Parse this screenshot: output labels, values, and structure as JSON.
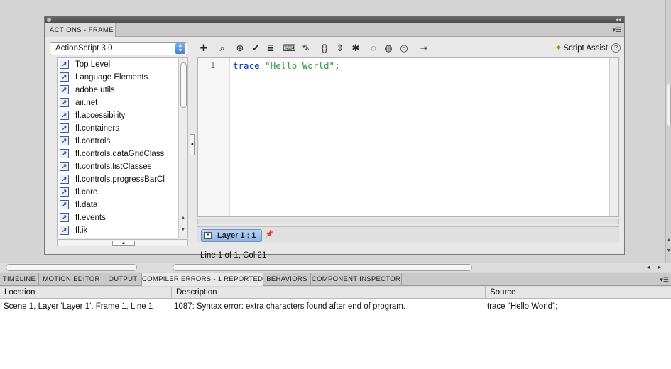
{
  "actions_panel": {
    "tab_label": "ACTIONS - FRAME",
    "language_select": "ActionScript 3.0",
    "tree_items": [
      "Top Level",
      "Language Elements",
      "adobe.utils",
      "air.net",
      "fl.accessibility",
      "fl.containers",
      "fl.controls",
      "fl.controls.dataGridClass",
      "fl.controls.listClasses",
      "fl.controls.progressBarCl",
      "fl.core",
      "fl.data",
      "fl.events",
      "fl.ik"
    ],
    "toolbar_icons": [
      "add-statement-icon",
      "find-icon",
      "insert-target-path-icon",
      "check-syntax-icon",
      "auto-format-icon",
      "show-code-hint-icon",
      "debug-options-icon",
      "collapse-between-braces-icon",
      "collapse-selection-icon",
      "expand-all-icon",
      "apply-block-comment-icon",
      "apply-line-comment-icon",
      "remove-comment-icon",
      "show-hide-toolbox-icon"
    ],
    "script_assist_label": "Script Assist",
    "help_label": "?",
    "editor": {
      "line_number": "1",
      "code_keyword": "trace",
      "code_string": "\"Hello World\"",
      "code_tail": ";"
    },
    "layer_tab": "Layer 1 : 1",
    "status": "Line 1 of 1, Col 21"
  },
  "bottom_tabs": [
    "TIMELINE",
    "MOTION EDITOR",
    "OUTPUT",
    "COMPILER ERRORS - 1 REPORTED",
    "BEHAVIORS",
    "COMPONENT INSPECTOR"
  ],
  "errors_table": {
    "columns": [
      "Location",
      "Description",
      "Source"
    ],
    "rows": [
      {
        "location": "Scene 1, Layer 'Layer 1', Frame 1, Line 1",
        "description": "1087: Syntax error: extra characters found after end of program.",
        "source": "trace \"Hello World\";"
      }
    ]
  },
  "colors": {
    "keyword": "#0033cc",
    "string": "#339933",
    "active_layer_tab": "#8eb4e6"
  }
}
